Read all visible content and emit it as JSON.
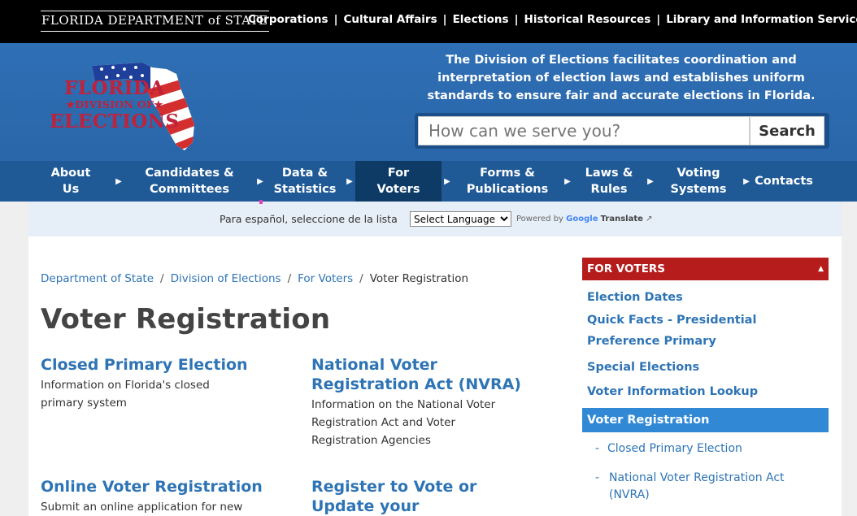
{
  "topbar": {
    "logo_text": "FLORIDA DEPARTMENT of STATE",
    "links": [
      "Corporations",
      "Cultural Affairs",
      "Elections",
      "Historical Resources",
      "Library and Information Services"
    ]
  },
  "header": {
    "logo_line1": "FLORIDA",
    "logo_line2": "★DIVISION OF★",
    "logo_line3": "ELECTIONS",
    "tagline": "The Division of Elections facilitates coordination and interpretation of election laws and establishes uniform standards to ensure fair and accurate elections in Florida.",
    "search_placeholder": "How can we serve you?",
    "search_button": "Search"
  },
  "nav": {
    "items": [
      {
        "label": "About Us"
      },
      {
        "label": "Candidates & Committees"
      },
      {
        "label": "Data & Statistics"
      },
      {
        "label": "For Voters"
      },
      {
        "label": "Forms & Publications"
      },
      {
        "label": "Laws & Rules"
      },
      {
        "label": "Voting Systems"
      },
      {
        "label": "Contacts"
      }
    ]
  },
  "language": {
    "label": "Para español, seleccione de la lista",
    "select_value": "Select Language",
    "powered_by": "Powered by",
    "google": "Google",
    "translate": "Translate"
  },
  "breadcrumb": [
    "Department of State",
    "Division of Elections",
    "For Voters",
    "Voter Registration"
  ],
  "page_title": "Voter Registration",
  "cards": [
    {
      "title": "Closed Primary Election",
      "desc": "Information on Florida's closed primary system"
    },
    {
      "title": "National Voter Registration Act (NVRA)",
      "desc": "Information on the National Voter Registration Act and Voter Registration Agencies"
    },
    {
      "title": "Online Voter Registration",
      "desc": "Submit an online application for new"
    },
    {
      "title": "Register to Vote or Update your Information",
      "desc": ""
    }
  ],
  "sidebar": {
    "heading": "FOR VOTERS",
    "links": [
      "Election Dates",
      "Quick Facts - Presidential Preference Primary",
      "Special Elections",
      "Voter Information Lookup"
    ],
    "active": "Voter Registration",
    "sublinks": [
      "Closed Primary Election",
      "National Voter Registration Act (NVRA)"
    ]
  },
  "colors": {
    "header_blue": "#2b6cb0",
    "nav_blue": "#1f5a96",
    "active_nav": "#0d3b66",
    "link": "#2e74b5",
    "sidebar_red": "#b71c1c",
    "sidebar_active": "#3189d6"
  }
}
